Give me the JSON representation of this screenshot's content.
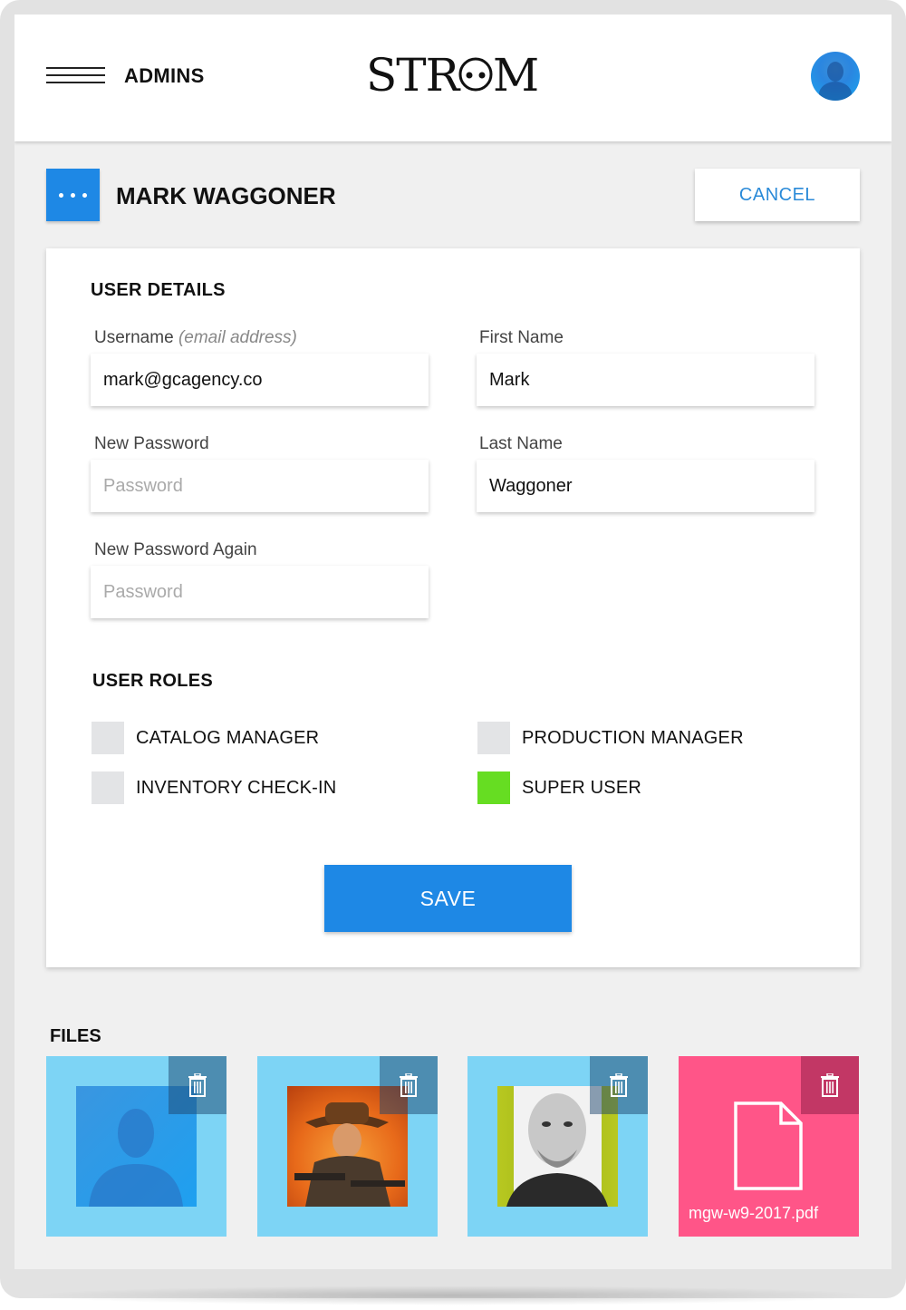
{
  "header": {
    "section_title": "ADMINS",
    "logo_text": "STR••M",
    "menu_icon": "hamburger-icon",
    "avatar_icon": "user-avatar"
  },
  "user": {
    "name": "MARK WAGGONER",
    "more_icon": "ellipsis-icon",
    "cancel_label": "CANCEL"
  },
  "user_details": {
    "heading": "USER DETAILS",
    "username_label": "Username",
    "username_hint": "(email address)",
    "username_value": "mark@gcagency.co",
    "first_name_label": "First Name",
    "first_name_value": "Mark",
    "new_password_label": "New Password",
    "new_password_placeholder": "Password",
    "last_name_label": "Last Name",
    "last_name_value": "Waggoner",
    "new_password_again_label": "New Password Again",
    "new_password_again_placeholder": "Password"
  },
  "user_roles": {
    "heading": "USER ROLES",
    "roles": [
      {
        "label": "CATALOG MANAGER",
        "checked": false
      },
      {
        "label": "PRODUCTION MANAGER",
        "checked": false
      },
      {
        "label": "INVENTORY CHECK-IN",
        "checked": false
      },
      {
        "label": "SUPER USER",
        "checked": true
      }
    ]
  },
  "save_label": "SAVE",
  "files": {
    "heading": "FILES",
    "items": [
      {
        "type": "image",
        "thumbnail": "silhouette-portrait"
      },
      {
        "type": "image",
        "thumbnail": "cowboy-poster"
      },
      {
        "type": "image",
        "thumbnail": "man-portrait"
      },
      {
        "type": "pdf",
        "name": "mgw-w9-2017.pdf",
        "icon": "document-icon"
      }
    ],
    "delete_icon": "trash-icon"
  },
  "colors": {
    "accent": "#1e88e5",
    "checked": "#66dd22",
    "tile_image": "#7dd4f5",
    "tile_pdf": "#ff5588"
  }
}
